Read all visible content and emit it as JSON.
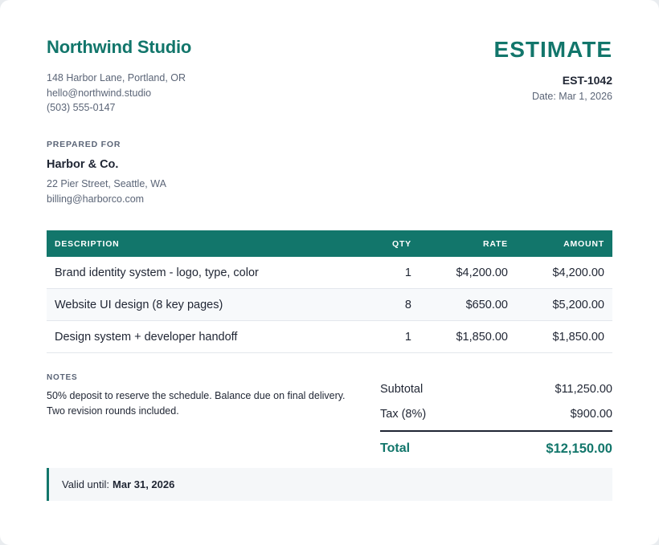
{
  "company": {
    "name": "Northwind Studio",
    "address": "148 Harbor Lane, Portland, OR",
    "email": "hello@northwind.studio",
    "phone": "(503) 555-0147"
  },
  "document": {
    "title": "ESTIMATE",
    "number": "EST-1042",
    "date": "Date: Mar 1, 2026"
  },
  "client": {
    "label": "PREPARED FOR",
    "name": "Harbor & Co.",
    "address": "22 Pier Street, Seattle, WA",
    "email": "billing@harborco.com"
  },
  "table": {
    "headers": {
      "description": "DESCRIPTION",
      "qty": "QTY",
      "rate": "RATE",
      "amount": "AMOUNT"
    },
    "rows": [
      {
        "description": "Brand identity system - logo, type, color",
        "qty": "1",
        "rate": "$4,200.00",
        "amount": "$4,200.00"
      },
      {
        "description": "Website UI design (8 key pages)",
        "qty": "8",
        "rate": "$650.00",
        "amount": "$5,200.00"
      },
      {
        "description": "Design system + developer handoff",
        "qty": "1",
        "rate": "$1,850.00",
        "amount": "$1,850.00"
      }
    ]
  },
  "notes": {
    "label": "NOTES",
    "text": "50% deposit to reserve the schedule. Balance due on final delivery. Two revision rounds included."
  },
  "totals": {
    "subtotal_label": "Subtotal",
    "subtotal_value": "$11,250.00",
    "tax_label": "Tax (8%)",
    "tax_value": "$900.00",
    "total_label": "Total",
    "total_value": "$12,150.00"
  },
  "validity": {
    "label": "Valid until:",
    "date": "Mar 31, 2026"
  },
  "colors": {
    "accent": "#12766b",
    "text": "#1f2533",
    "muted": "#5b6577"
  }
}
